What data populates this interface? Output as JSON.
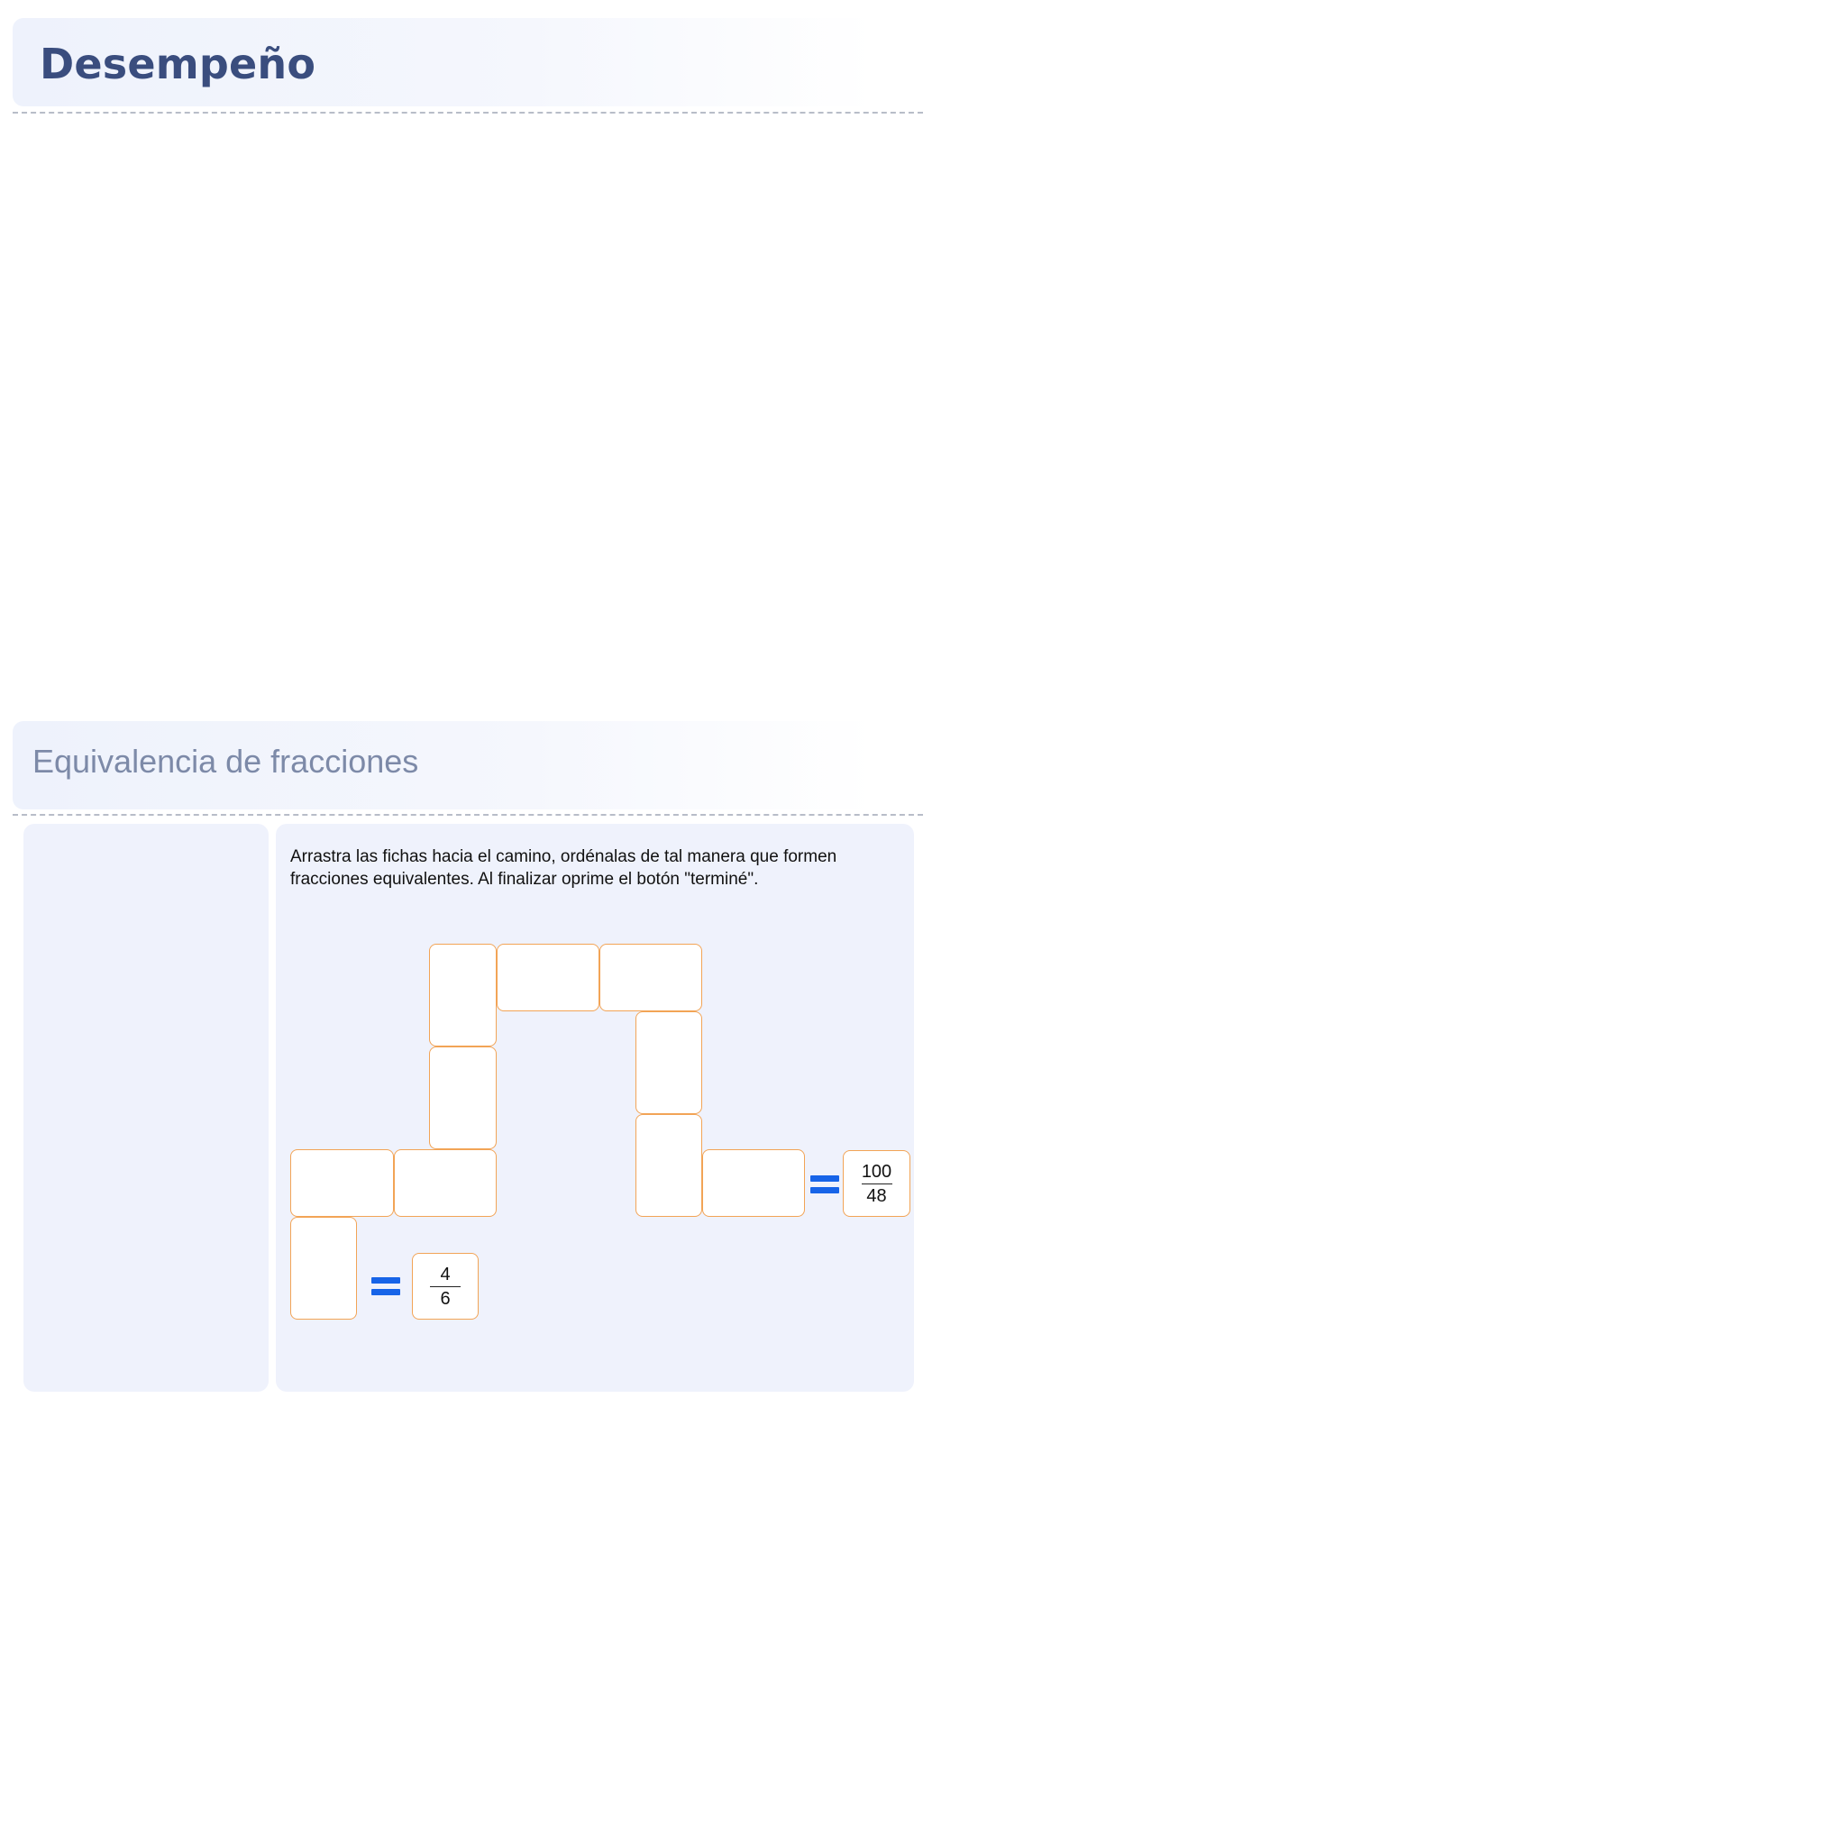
{
  "header": {
    "title": "Desempeño"
  },
  "activity": {
    "title": "Equivalencia de fracciones",
    "instructions": "Arrastra las fichas hacia el camino, ordénalas de tal manera que formen fracciones equivalentes. Al finalizar oprime el botón \"terminé\".",
    "target_end": {
      "numerator": "100",
      "denominator": "48"
    },
    "target_start": {
      "numerator": "4",
      "denominator": "6"
    }
  },
  "colors": {
    "title": "#3a4d7e",
    "subtitle": "#7d8aa8",
    "panel_bg": "#eff2fc",
    "slot_border": "#f2a456",
    "equals_sign": "#1764e8"
  }
}
